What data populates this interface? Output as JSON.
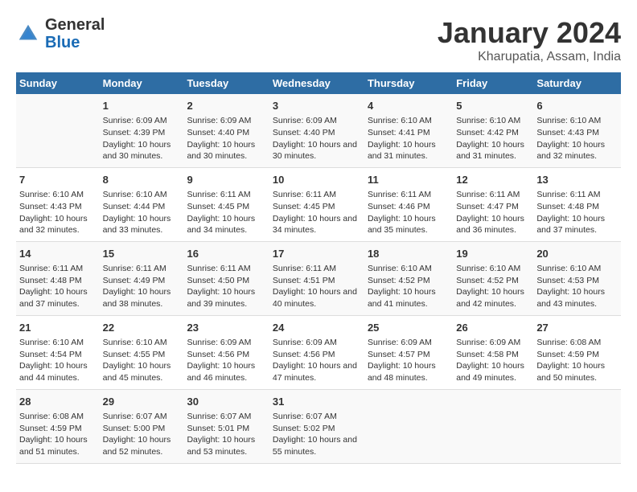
{
  "header": {
    "logo_general": "General",
    "logo_blue": "Blue",
    "main_title": "January 2024",
    "subtitle": "Kharupatia, Assam, India"
  },
  "days_of_week": [
    "Sunday",
    "Monday",
    "Tuesday",
    "Wednesday",
    "Thursday",
    "Friday",
    "Saturday"
  ],
  "weeks": [
    [
      {
        "day": "",
        "sunrise": "",
        "sunset": "",
        "daylight": ""
      },
      {
        "day": "1",
        "sunrise": "Sunrise: 6:09 AM",
        "sunset": "Sunset: 4:39 PM",
        "daylight": "Daylight: 10 hours and 30 minutes."
      },
      {
        "day": "2",
        "sunrise": "Sunrise: 6:09 AM",
        "sunset": "Sunset: 4:40 PM",
        "daylight": "Daylight: 10 hours and 30 minutes."
      },
      {
        "day": "3",
        "sunrise": "Sunrise: 6:09 AM",
        "sunset": "Sunset: 4:40 PM",
        "daylight": "Daylight: 10 hours and 30 minutes."
      },
      {
        "day": "4",
        "sunrise": "Sunrise: 6:10 AM",
        "sunset": "Sunset: 4:41 PM",
        "daylight": "Daylight: 10 hours and 31 minutes."
      },
      {
        "day": "5",
        "sunrise": "Sunrise: 6:10 AM",
        "sunset": "Sunset: 4:42 PM",
        "daylight": "Daylight: 10 hours and 31 minutes."
      },
      {
        "day": "6",
        "sunrise": "Sunrise: 6:10 AM",
        "sunset": "Sunset: 4:43 PM",
        "daylight": "Daylight: 10 hours and 32 minutes."
      }
    ],
    [
      {
        "day": "7",
        "sunrise": "Sunrise: 6:10 AM",
        "sunset": "Sunset: 4:43 PM",
        "daylight": "Daylight: 10 hours and 32 minutes."
      },
      {
        "day": "8",
        "sunrise": "Sunrise: 6:10 AM",
        "sunset": "Sunset: 4:44 PM",
        "daylight": "Daylight: 10 hours and 33 minutes."
      },
      {
        "day": "9",
        "sunrise": "Sunrise: 6:11 AM",
        "sunset": "Sunset: 4:45 PM",
        "daylight": "Daylight: 10 hours and 34 minutes."
      },
      {
        "day": "10",
        "sunrise": "Sunrise: 6:11 AM",
        "sunset": "Sunset: 4:45 PM",
        "daylight": "Daylight: 10 hours and 34 minutes."
      },
      {
        "day": "11",
        "sunrise": "Sunrise: 6:11 AM",
        "sunset": "Sunset: 4:46 PM",
        "daylight": "Daylight: 10 hours and 35 minutes."
      },
      {
        "day": "12",
        "sunrise": "Sunrise: 6:11 AM",
        "sunset": "Sunset: 4:47 PM",
        "daylight": "Daylight: 10 hours and 36 minutes."
      },
      {
        "day": "13",
        "sunrise": "Sunrise: 6:11 AM",
        "sunset": "Sunset: 4:48 PM",
        "daylight": "Daylight: 10 hours and 37 minutes."
      }
    ],
    [
      {
        "day": "14",
        "sunrise": "Sunrise: 6:11 AM",
        "sunset": "Sunset: 4:48 PM",
        "daylight": "Daylight: 10 hours and 37 minutes."
      },
      {
        "day": "15",
        "sunrise": "Sunrise: 6:11 AM",
        "sunset": "Sunset: 4:49 PM",
        "daylight": "Daylight: 10 hours and 38 minutes."
      },
      {
        "day": "16",
        "sunrise": "Sunrise: 6:11 AM",
        "sunset": "Sunset: 4:50 PM",
        "daylight": "Daylight: 10 hours and 39 minutes."
      },
      {
        "day": "17",
        "sunrise": "Sunrise: 6:11 AM",
        "sunset": "Sunset: 4:51 PM",
        "daylight": "Daylight: 10 hours and 40 minutes."
      },
      {
        "day": "18",
        "sunrise": "Sunrise: 6:10 AM",
        "sunset": "Sunset: 4:52 PM",
        "daylight": "Daylight: 10 hours and 41 minutes."
      },
      {
        "day": "19",
        "sunrise": "Sunrise: 6:10 AM",
        "sunset": "Sunset: 4:52 PM",
        "daylight": "Daylight: 10 hours and 42 minutes."
      },
      {
        "day": "20",
        "sunrise": "Sunrise: 6:10 AM",
        "sunset": "Sunset: 4:53 PM",
        "daylight": "Daylight: 10 hours and 43 minutes."
      }
    ],
    [
      {
        "day": "21",
        "sunrise": "Sunrise: 6:10 AM",
        "sunset": "Sunset: 4:54 PM",
        "daylight": "Daylight: 10 hours and 44 minutes."
      },
      {
        "day": "22",
        "sunrise": "Sunrise: 6:10 AM",
        "sunset": "Sunset: 4:55 PM",
        "daylight": "Daylight: 10 hours and 45 minutes."
      },
      {
        "day": "23",
        "sunrise": "Sunrise: 6:09 AM",
        "sunset": "Sunset: 4:56 PM",
        "daylight": "Daylight: 10 hours and 46 minutes."
      },
      {
        "day": "24",
        "sunrise": "Sunrise: 6:09 AM",
        "sunset": "Sunset: 4:56 PM",
        "daylight": "Daylight: 10 hours and 47 minutes."
      },
      {
        "day": "25",
        "sunrise": "Sunrise: 6:09 AM",
        "sunset": "Sunset: 4:57 PM",
        "daylight": "Daylight: 10 hours and 48 minutes."
      },
      {
        "day": "26",
        "sunrise": "Sunrise: 6:09 AM",
        "sunset": "Sunset: 4:58 PM",
        "daylight": "Daylight: 10 hours and 49 minutes."
      },
      {
        "day": "27",
        "sunrise": "Sunrise: 6:08 AM",
        "sunset": "Sunset: 4:59 PM",
        "daylight": "Daylight: 10 hours and 50 minutes."
      }
    ],
    [
      {
        "day": "28",
        "sunrise": "Sunrise: 6:08 AM",
        "sunset": "Sunset: 4:59 PM",
        "daylight": "Daylight: 10 hours and 51 minutes."
      },
      {
        "day": "29",
        "sunrise": "Sunrise: 6:07 AM",
        "sunset": "Sunset: 5:00 PM",
        "daylight": "Daylight: 10 hours and 52 minutes."
      },
      {
        "day": "30",
        "sunrise": "Sunrise: 6:07 AM",
        "sunset": "Sunset: 5:01 PM",
        "daylight": "Daylight: 10 hours and 53 minutes."
      },
      {
        "day": "31",
        "sunrise": "Sunrise: 6:07 AM",
        "sunset": "Sunset: 5:02 PM",
        "daylight": "Daylight: 10 hours and 55 minutes."
      },
      {
        "day": "",
        "sunrise": "",
        "sunset": "",
        "daylight": ""
      },
      {
        "day": "",
        "sunrise": "",
        "sunset": "",
        "daylight": ""
      },
      {
        "day": "",
        "sunrise": "",
        "sunset": "",
        "daylight": ""
      }
    ]
  ]
}
